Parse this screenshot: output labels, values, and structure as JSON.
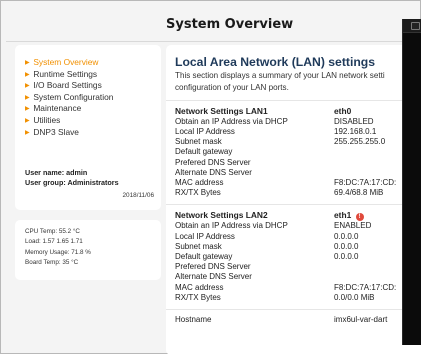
{
  "header": {
    "title": "System Overview"
  },
  "nav": {
    "items": [
      {
        "label": "System Overview",
        "active": true
      },
      {
        "label": "Runtime Settings",
        "active": false
      },
      {
        "label": "I/O Board Settings",
        "active": false
      },
      {
        "label": "System Configuration",
        "active": false
      },
      {
        "label": "Maintenance",
        "active": false
      },
      {
        "label": "Utilities",
        "active": false
      },
      {
        "label": "DNP3 Slave",
        "active": false
      }
    ],
    "bullet_icon": "triangle-right-icon",
    "accent_color": "#f19000"
  },
  "user": {
    "name_line": "User name: admin",
    "group_line": "User group: Administrators",
    "date": "2018/11/06"
  },
  "stats": {
    "cpu": "CPU Temp: 55.2 °C",
    "load": "Load: 1.57  1.65  1.71",
    "memory": "Memory Usage: 71.8 %",
    "board": "Board Temp: 35 °C"
  },
  "lan": {
    "title": "Local Area Network (LAN) settings",
    "desc_line1": "This section displays a summary of your LAN network setti",
    "desc_line2": "configuration of your LAN ports.",
    "title_color": "#1f3a5a",
    "lan1": {
      "heading": "Network Settings LAN1",
      "iface": "eth0",
      "rows": [
        {
          "k": "Obtain an IP Address via DHCP",
          "v": "DISABLED"
        },
        {
          "k": "Local IP Address",
          "v": "192.168.0.1"
        },
        {
          "k": "Subnet mask",
          "v": "255.255.255.0"
        },
        {
          "k": "Default gateway",
          "v": ""
        },
        {
          "k": "Prefered DNS Server",
          "v": ""
        },
        {
          "k": "Alternate DNS Server",
          "v": ""
        },
        {
          "k": "MAC address",
          "v": "F8:DC:7A:17:CD:"
        },
        {
          "k": "RX/TX Bytes",
          "v": "69.4/68.8 MiB"
        }
      ]
    },
    "lan2": {
      "heading": "Network Settings LAN2",
      "iface": "eth1",
      "status_icon": "error-icon",
      "status_color": "#e04a3c",
      "rows": [
        {
          "k": "Obtain an IP Address via DHCP",
          "v": "ENABLED"
        },
        {
          "k": "Local IP Address",
          "v": "0.0.0.0"
        },
        {
          "k": "Subnet mask",
          "v": "0.0.0.0"
        },
        {
          "k": "Default gateway",
          "v": "0.0.0.0"
        },
        {
          "k": "Prefered DNS Server",
          "v": ""
        },
        {
          "k": "Alternate DNS Server",
          "v": ""
        },
        {
          "k": "MAC address",
          "v": "F8:DC:7A:17:CD:"
        },
        {
          "k": "RX/TX Bytes",
          "v": "0.0/0.0 MiB"
        }
      ]
    },
    "hostname": {
      "k": "Hostname",
      "v": "imx6ul-var-dart"
    }
  }
}
